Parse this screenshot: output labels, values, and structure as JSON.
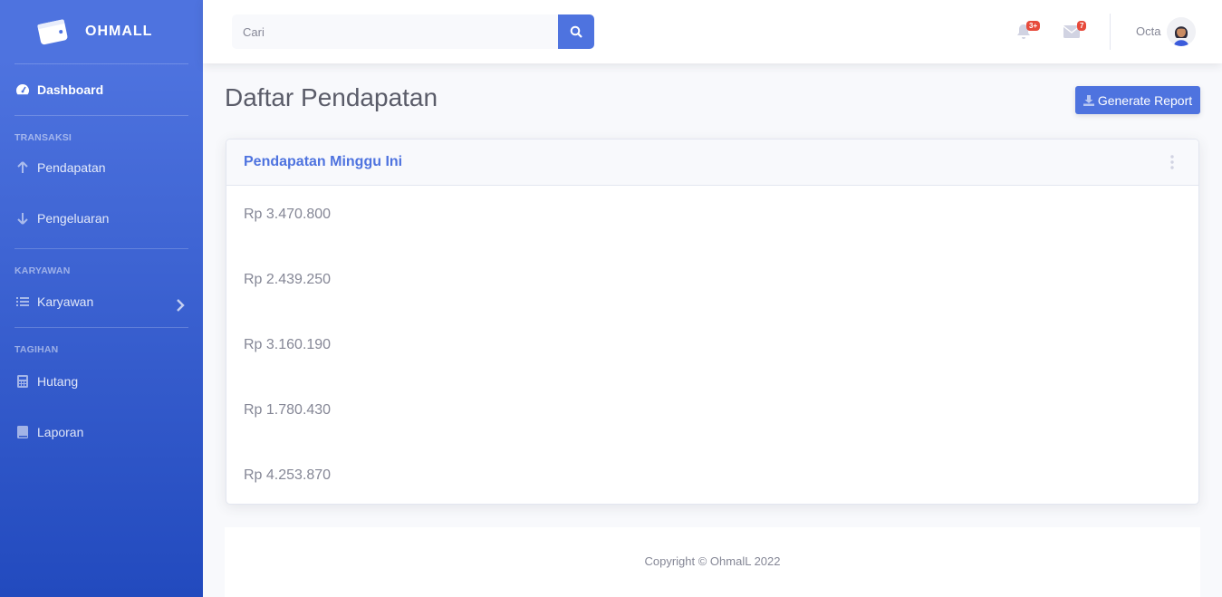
{
  "brand": {
    "name": "OHMALL",
    "icon": "wallet-icon"
  },
  "sidebar": {
    "dashboard": {
      "label": "Dashboard",
      "icon": "tachometer-icon"
    },
    "headings": {
      "transaksi": "TRANSAKSI",
      "karyawan": "KARYAWAN",
      "tagihan": "TAGIHAN"
    },
    "items": [
      {
        "label": "Pendapatan",
        "icon": "arrow-up-icon"
      },
      {
        "label": "Pengeluaran",
        "icon": "arrow-down-icon"
      },
      {
        "label": "Karyawan",
        "icon": "list-icon"
      },
      {
        "label": "Hutang",
        "icon": "calculator-icon"
      },
      {
        "label": "Laporan",
        "icon": "book-icon"
      }
    ]
  },
  "topbar": {
    "search_placeholder": "Cari",
    "alerts_count": "3+",
    "messages_count": "7",
    "user_name": "Octa"
  },
  "main": {
    "title": "Daftar Pendapatan",
    "generate_label": "Generate Report",
    "card_title": "Pendapatan Minggu Ini",
    "amounts": [
      "Rp 3.470.800",
      "Rp 2.439.250",
      "Rp 3.160.190",
      "Rp 1.780.430",
      "Rp 4.253.870"
    ]
  },
  "footer": {
    "copyright": "Copyright © OhmalL 2022"
  },
  "colors": {
    "primary": "#4e73df",
    "sidebar_end": "#224abe",
    "badge": "#e74a3b",
    "text": "#858796"
  }
}
